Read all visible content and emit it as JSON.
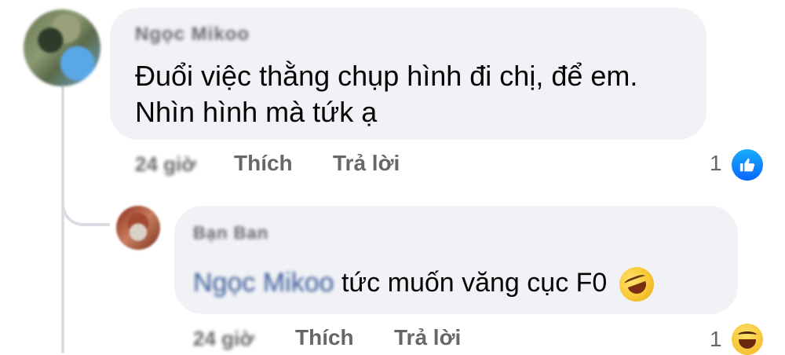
{
  "comment": {
    "author": "Ngọc Mikoo",
    "text_line1": "Đuổi việc thằng chụp hình đi chị, để em.",
    "text_line2": "Nhìn hình mà tứk ạ",
    "time": "24 giờ",
    "like_label": "Thích",
    "reply_label": "Trả lời",
    "reaction_count": "1",
    "reaction_icon": "like-icon"
  },
  "reply": {
    "author": "Bạn Ban",
    "mention": "Ngọc Mikoo",
    "text": "tức muốn văng cục F0",
    "emoji": "rolling-on-floor-laughing-emoji",
    "time": "24 giờ",
    "like_label": "Thích",
    "reply_label": "Trả lời",
    "reaction_count": "1",
    "reaction_icon": "haha-icon"
  },
  "colors": {
    "bubble": "#f0f2f5",
    "meta_text": "#65676b",
    "like_blue": "#0866ff",
    "mention": "#385898"
  }
}
